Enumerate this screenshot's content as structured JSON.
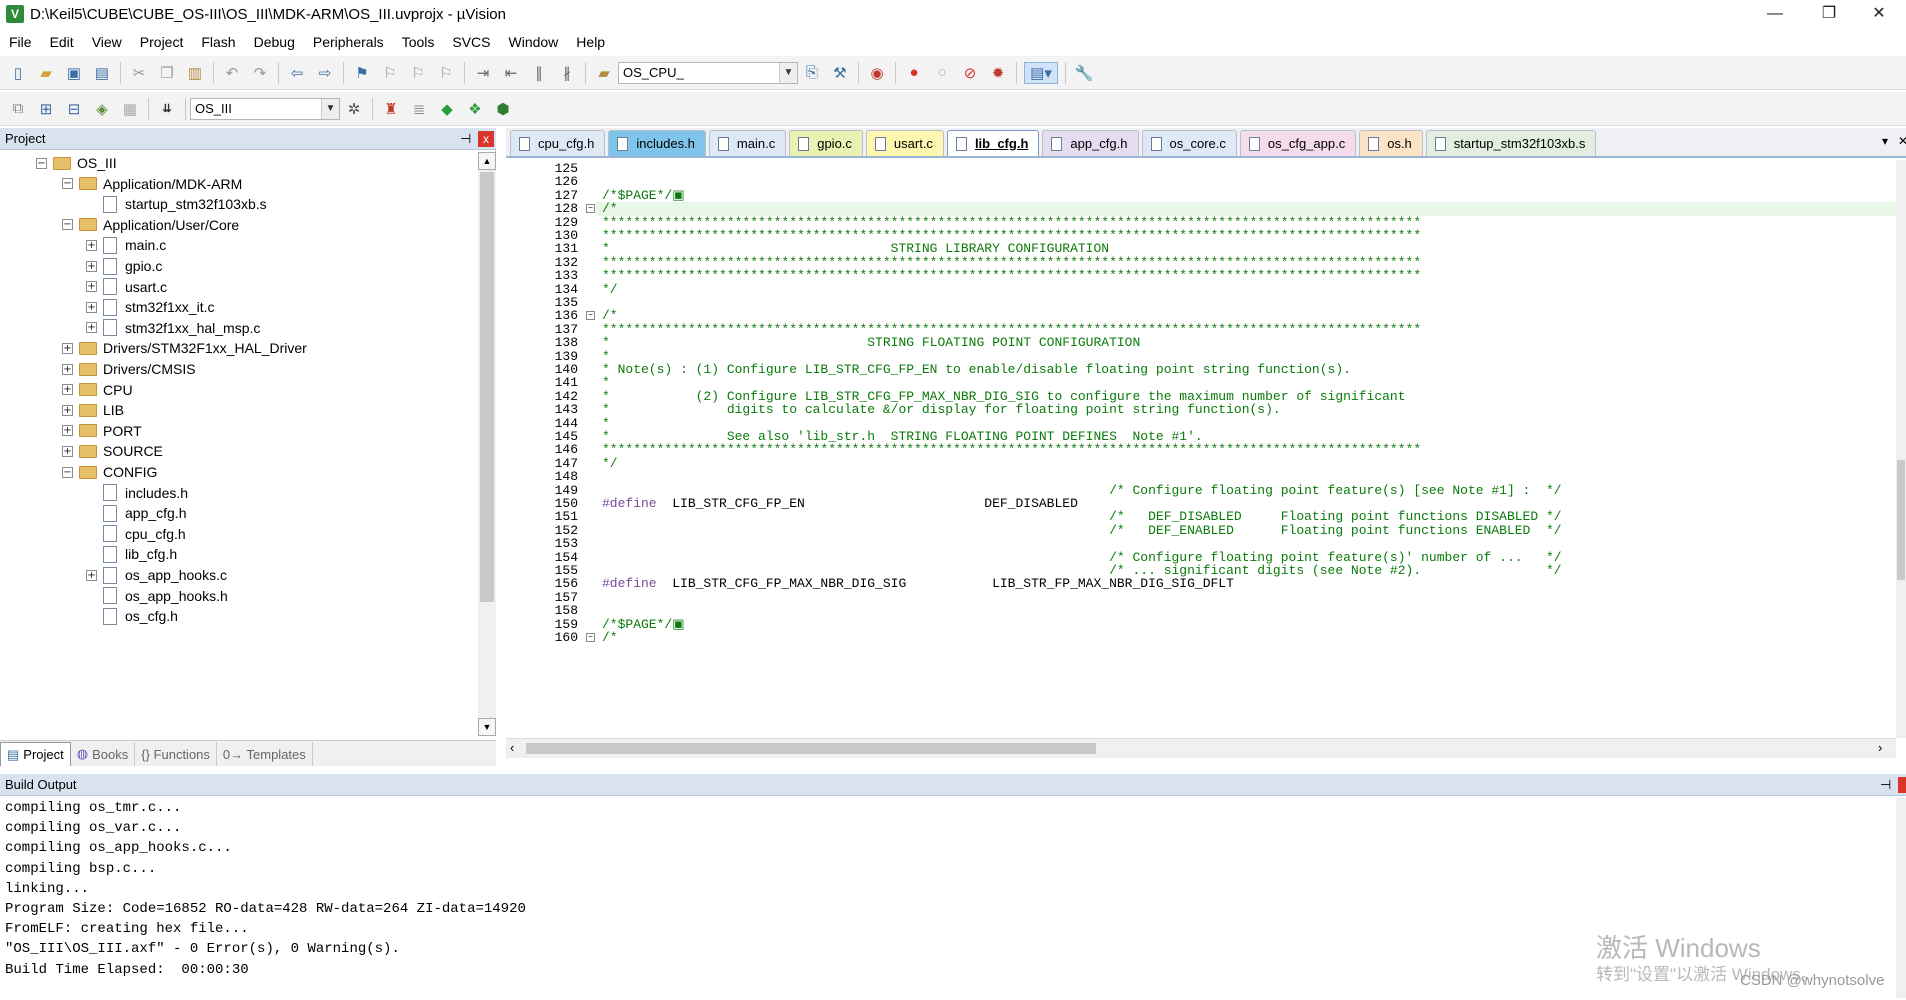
{
  "window": {
    "title": "D:\\Keil5\\CUBE\\CUBE_OS-III\\OS_III\\MDK-ARM\\OS_III.uvprojx - µVision",
    "minimize": "—",
    "maximize": "❐",
    "close": "✕"
  },
  "menu": [
    "File",
    "Edit",
    "View",
    "Project",
    "Flash",
    "Debug",
    "Peripherals",
    "Tools",
    "SVCS",
    "Window",
    "Help"
  ],
  "toolbar": {
    "find_combo_value": "OS_CPU_",
    "target_combo_value": "OS_III"
  },
  "project_panel": {
    "title": "Project",
    "pin": "⊣",
    "close": "x",
    "tree": [
      {
        "label": "OS_III",
        "level": 1,
        "type": "root",
        "expander": "−"
      },
      {
        "label": "Application/MDK-ARM",
        "level": 2,
        "type": "folder",
        "expander": "−"
      },
      {
        "label": "startup_stm32f103xb.s",
        "level": 3,
        "type": "file",
        "expander": ""
      },
      {
        "label": "Application/User/Core",
        "level": 2,
        "type": "folder",
        "expander": "−"
      },
      {
        "label": "main.c",
        "level": 3,
        "type": "file",
        "expander": "+"
      },
      {
        "label": "gpio.c",
        "level": 3,
        "type": "file",
        "expander": "+"
      },
      {
        "label": "usart.c",
        "level": 3,
        "type": "file",
        "expander": "+"
      },
      {
        "label": "stm32f1xx_it.c",
        "level": 3,
        "type": "file",
        "expander": "+"
      },
      {
        "label": "stm32f1xx_hal_msp.c",
        "level": 3,
        "type": "file",
        "expander": "+"
      },
      {
        "label": "Drivers/STM32F1xx_HAL_Driver",
        "level": 2,
        "type": "folder",
        "expander": "+"
      },
      {
        "label": "Drivers/CMSIS",
        "level": 2,
        "type": "folder",
        "expander": "+"
      },
      {
        "label": "CPU",
        "level": 2,
        "type": "folder",
        "expander": "+"
      },
      {
        "label": "LIB",
        "level": 2,
        "type": "folder",
        "expander": "+"
      },
      {
        "label": "PORT",
        "level": 2,
        "type": "folder",
        "expander": "+"
      },
      {
        "label": "SOURCE",
        "level": 2,
        "type": "folder",
        "expander": "+"
      },
      {
        "label": "CONFIG",
        "level": 2,
        "type": "folder",
        "expander": "−"
      },
      {
        "label": "includes.h",
        "level": 3,
        "type": "file",
        "expander": ""
      },
      {
        "label": "app_cfg.h",
        "level": 3,
        "type": "file",
        "expander": ""
      },
      {
        "label": "cpu_cfg.h",
        "level": 3,
        "type": "file",
        "expander": ""
      },
      {
        "label": "lib_cfg.h",
        "level": 3,
        "type": "file",
        "expander": ""
      },
      {
        "label": "os_app_hooks.c",
        "level": 3,
        "type": "file",
        "expander": "+"
      },
      {
        "label": "os_app_hooks.h",
        "level": 3,
        "type": "file",
        "expander": ""
      },
      {
        "label": "os_cfg.h",
        "level": 3,
        "type": "file",
        "expander": ""
      }
    ],
    "bottom_tabs": [
      "Project",
      "Books",
      "{} Functions",
      "0→ Templates"
    ]
  },
  "editor": {
    "tabs": [
      {
        "label": "cpu_cfg.h",
        "color": "#dfe9f6"
      },
      {
        "label": "includes.h",
        "color": "#7fc4ea"
      },
      {
        "label": "main.c",
        "color": "#dfe9f6"
      },
      {
        "label": "gpio.c",
        "color": "#e9f1b3"
      },
      {
        "label": "usart.c",
        "color": "#fff6b0"
      },
      {
        "label": "lib_cfg.h",
        "color": "#ffffff",
        "active": true
      },
      {
        "label": "app_cfg.h",
        "color": "#e6dcef"
      },
      {
        "label": "os_core.c",
        "color": "#dfe9f6"
      },
      {
        "label": "os_cfg_app.c",
        "color": "#f5dcea"
      },
      {
        "label": "os.h",
        "color": "#fbe3c6"
      },
      {
        "label": "startup_stm32f103xb.s",
        "color": "#e2eee0"
      }
    ],
    "tab_menu": "▾",
    "close": "✕",
    "lines": [
      {
        "n": "125",
        "code": ""
      },
      {
        "n": "126",
        "code": ""
      },
      {
        "n": "127",
        "code": "/*$PAGE*/▣"
      },
      {
        "n": "128",
        "code": "/*",
        "fold": "−",
        "current": true
      },
      {
        "n": "129",
        "code": "*********************************************************************************************************"
      },
      {
        "n": "130",
        "code": "*********************************************************************************************************"
      },
      {
        "n": "131",
        "code": "*                                    STRING LIBRARY CONFIGURATION"
      },
      {
        "n": "132",
        "code": "*********************************************************************************************************"
      },
      {
        "n": "133",
        "code": "*********************************************************************************************************"
      },
      {
        "n": "134",
        "code": "*/"
      },
      {
        "n": "135",
        "code": ""
      },
      {
        "n": "136",
        "code": "/*",
        "fold": "−"
      },
      {
        "n": "137",
        "code": "*********************************************************************************************************"
      },
      {
        "n": "138",
        "code": "*                                 STRING FLOATING POINT CONFIGURATION"
      },
      {
        "n": "139",
        "code": "*"
      },
      {
        "n": "140",
        "code": "* Note(s) : (1) Configure LIB_STR_CFG_FP_EN to enable/disable floating point string function(s)."
      },
      {
        "n": "141",
        "code": "*"
      },
      {
        "n": "142",
        "code": "*           (2) Configure LIB_STR_CFG_FP_MAX_NBR_DIG_SIG to configure the maximum number of significant"
      },
      {
        "n": "143",
        "code": "*               digits to calculate &/or display for floating point string function(s)."
      },
      {
        "n": "144",
        "code": "*"
      },
      {
        "n": "145",
        "code": "*               See also 'lib_str.h  STRING FLOATING POINT DEFINES  Note #1'."
      },
      {
        "n": "146",
        "code": "*********************************************************************************************************"
      },
      {
        "n": "147",
        "code": "*/"
      },
      {
        "n": "148",
        "code": ""
      },
      {
        "n": "149",
        "code": "                                                                 /* Configure floating point feature(s) [see Note #1] :  */"
      },
      {
        "n": "150",
        "code": "#define  LIB_STR_CFG_FP_EN                       DEF_DISABLED",
        "define": true
      },
      {
        "n": "151",
        "code": "                                                                 /*   DEF_DISABLED     Floating point functions DISABLED */"
      },
      {
        "n": "152",
        "code": "                                                                 /*   DEF_ENABLED      Floating point functions ENABLED  */"
      },
      {
        "n": "153",
        "code": ""
      },
      {
        "n": "154",
        "code": "                                                                 /* Configure floating point feature(s)' number of ...   */"
      },
      {
        "n": "155",
        "code": "                                                                 /* ... significant digits (see Note #2).                */"
      },
      {
        "n": "156",
        "code": "#define  LIB_STR_CFG_FP_MAX_NBR_DIG_SIG           LIB_STR_FP_MAX_NBR_DIG_SIG_DFLT",
        "define": true
      },
      {
        "n": "157",
        "code": ""
      },
      {
        "n": "158",
        "code": ""
      },
      {
        "n": "159",
        "code": "/*$PAGE*/▣"
      },
      {
        "n": "160",
        "code": "/*",
        "fold": "−"
      }
    ]
  },
  "build_output": {
    "title": "Build Output",
    "lines": [
      "compiling os_tmr.c...",
      "compiling os_var.c...",
      "compiling os_app_hooks.c...",
      "compiling bsp.c...",
      "linking...",
      "Program Size: Code=16852 RO-data=428 RW-data=264 ZI-data=14920",
      "FromELF: creating hex file...",
      "\"OS_III\\OS_III.axf\" - 0 Error(s), 0 Warning(s).",
      "Build Time Elapsed:  00:00:30"
    ]
  },
  "overlay": {
    "activate_title": "激活 Windows",
    "activate_sub": "转到\"设置\"以激活 Windows。",
    "csdn": "CSDN @whynotsolve"
  }
}
